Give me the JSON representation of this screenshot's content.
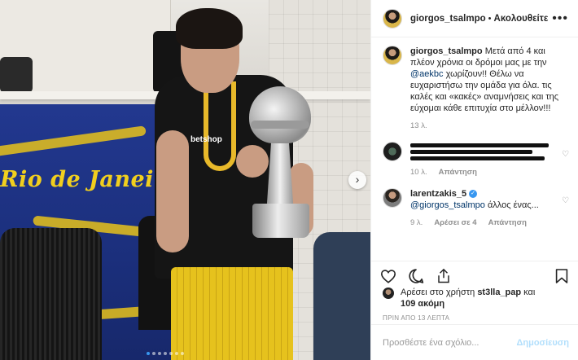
{
  "post": {
    "username": "giorgos_tsalmpo",
    "separator": "•",
    "follow_label": "Ακολουθείτε",
    "more_icon": "more-options-icon",
    "photo": {
      "banner_text": "Rio de Janeiro",
      "shirt_logo": "betshop"
    }
  },
  "caption": {
    "username": "giorgos_tsalmpo",
    "text_before": "Μετά από 4 και πλέον χρόνια οι δρόμοι μας με την ",
    "mention": "@aekbc",
    "text_after": " χωρίζουν!! Θέλω να ευχαριστήσω την ομάδα για όλα. τις καλές και «κακές» αναμνήσεις και της εύχομαι κάθε επιτυχία στο μέλλον!!!",
    "time_ago": "13 λ."
  },
  "comments": [
    {
      "username": "",
      "redacted": true,
      "time_ago": "10 λ.",
      "reply_label": "Απάντηση"
    },
    {
      "username": "larentzakis_5",
      "verified": true,
      "mention": "@giorgos_tsalmpo",
      "text": " άλλος ένας...",
      "time_ago": "9 λ.",
      "likes_label": "Αρέσει σε 4",
      "reply_label": "Απάντηση"
    }
  ],
  "likes": {
    "prefix": "Αρέσει στο χρήστη ",
    "user": "st3lla_pap",
    "connector": " και",
    "others": "109 ακόμη"
  },
  "timestamp": "ΠΡΙΝ ΑΠΟ 13 ΛΕΠΤΑ",
  "add_comment": {
    "placeholder": "Προσθέστε ένα σχόλιο...",
    "post_label": "Δημοσίευση"
  },
  "colors": {
    "mention": "#003569",
    "verified": "#3897f0",
    "post_disabled": "#b2dffc",
    "secondary_text": "#8e8e8e"
  }
}
